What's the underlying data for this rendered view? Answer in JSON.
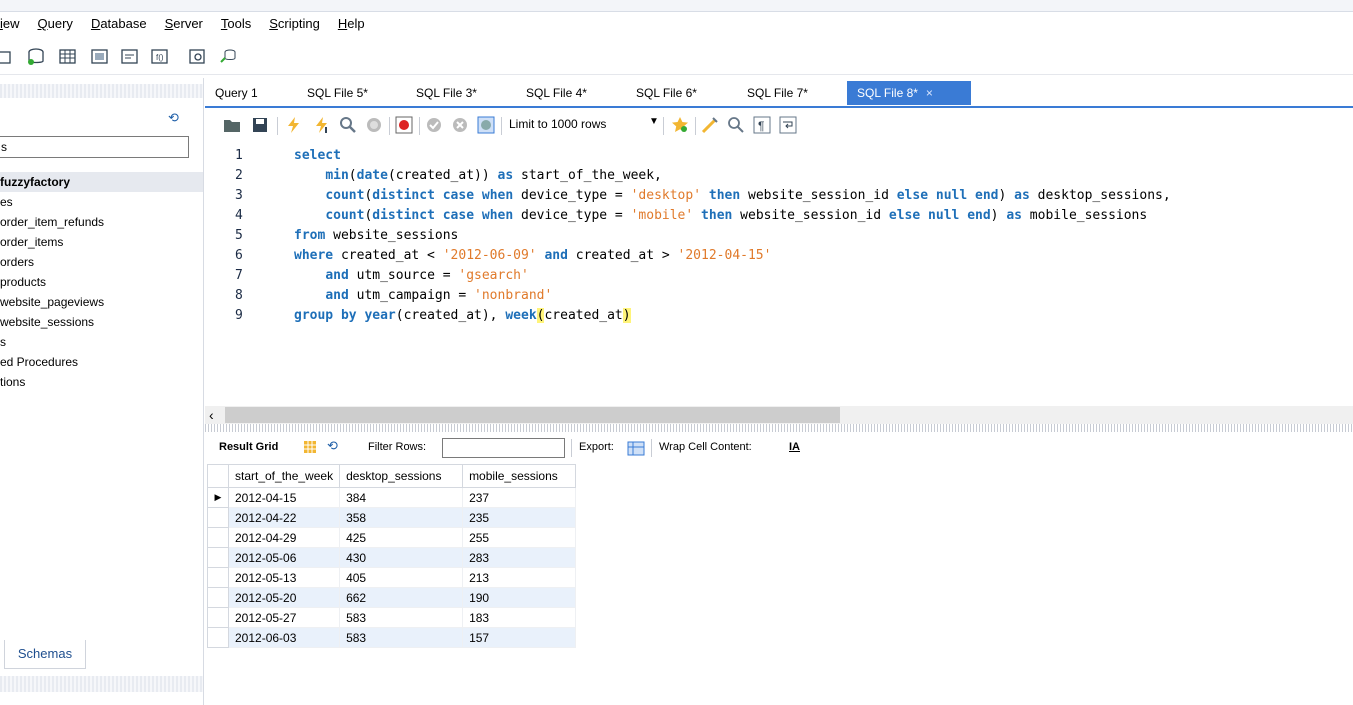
{
  "menu": [
    "iew",
    "Query",
    "Database",
    "Server",
    "Tools",
    "Scripting",
    "Help"
  ],
  "sidebar": {
    "filter_value": "s",
    "schema": "fuzzyfactory",
    "items": [
      "es",
      "order_item_refunds",
      "order_items",
      "orders",
      "products",
      "website_pageviews",
      "website_sessions",
      "s",
      "ed Procedures",
      "tions"
    ],
    "tab_label": "Schemas"
  },
  "tabs": [
    {
      "label": "Query 1"
    },
    {
      "label": "SQL File 5*"
    },
    {
      "label": "SQL File 3*"
    },
    {
      "label": "SQL File 4*"
    },
    {
      "label": "SQL File 6*"
    },
    {
      "label": "SQL File 7*"
    },
    {
      "label": "SQL File 8*",
      "active": true
    }
  ],
  "toolbar": {
    "limit_label": "Limit to 1000 rows"
  },
  "code_lines": [
    {
      "n": "1"
    },
    {
      "n": "2"
    },
    {
      "n": "3"
    },
    {
      "n": "4"
    },
    {
      "n": "5"
    },
    {
      "n": "6"
    },
    {
      "n": "7"
    },
    {
      "n": "8"
    },
    {
      "n": "9"
    }
  ],
  "results_toolbar": {
    "result_grid": "Result Grid",
    "filter_rows": "Filter Rows:",
    "export": "Export:",
    "wrap": "Wrap Cell Content:"
  },
  "grid": {
    "columns": [
      "start_of_the_week",
      "desktop_sessions",
      "mobile_sessions"
    ],
    "rows": [
      [
        "2012-04-15",
        "384",
        "237"
      ],
      [
        "2012-04-22",
        "358",
        "235"
      ],
      [
        "2012-04-29",
        "425",
        "255"
      ],
      [
        "2012-05-06",
        "430",
        "283"
      ],
      [
        "2012-05-13",
        "405",
        "213"
      ],
      [
        "2012-05-20",
        "662",
        "190"
      ],
      [
        "2012-05-27",
        "583",
        "183"
      ],
      [
        "2012-06-03",
        "583",
        "157"
      ]
    ]
  },
  "colors": {
    "accent": "#3a7bd5",
    "keyword": "#1e6fb8",
    "string": "#e07a2b"
  }
}
